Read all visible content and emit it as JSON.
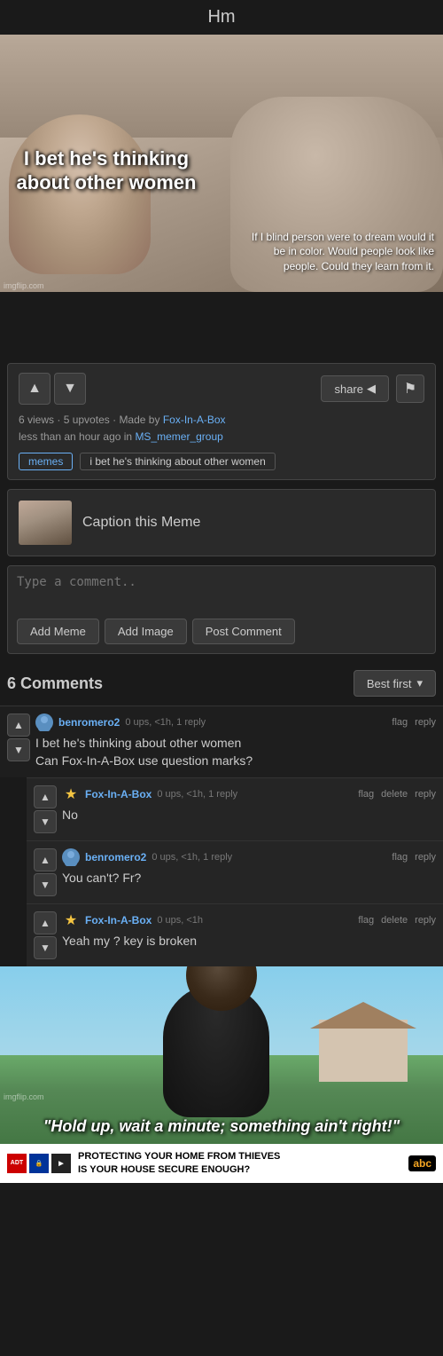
{
  "page": {
    "title": "Hm"
  },
  "meme": {
    "top_text": "I bet he's thinking about other women",
    "bottom_text_right": "If I blind person were to dream would it be in color. Would people look like people. Could they learn from it.",
    "credit": "imgflip.com"
  },
  "actions": {
    "share_label": "share",
    "upvote_icon": "▲",
    "downvote_icon": "▼",
    "flag_icon": "⚑"
  },
  "meta": {
    "views": "6 views",
    "upvotes": "5 upvotes",
    "made_by_prefix": "Made by",
    "author": "Fox-In-A-Box",
    "posted_time": "less than an hour ago in",
    "group": "MS_memer_group"
  },
  "tags": {
    "tag1": "memes",
    "tag2": "i bet he's thinking about other women"
  },
  "caption": {
    "text": "Caption this Meme"
  },
  "comment_input": {
    "placeholder": "Type a comment..",
    "btn_add_meme": "Add Meme",
    "btn_add_image": "Add Image",
    "btn_post": "Post Comment"
  },
  "comments_section": {
    "header": "6 Comments",
    "sort_label": "Best first",
    "sort_icon": "▾"
  },
  "comments": [
    {
      "id": "c1",
      "username": "benromero2",
      "avatar_type": "user",
      "stats": "0 ups, <1h, 1 reply",
      "actions": [
        "flag",
        "reply"
      ],
      "text": "I bet he's thinking about other women\nCan Fox-In-A-Box use question marks?",
      "indented": false
    },
    {
      "id": "c2",
      "username": "Fox-In-A-Box",
      "avatar_type": "star",
      "stats": "0 ups, <1h, 1 reply",
      "actions": [
        "flag",
        "delete",
        "reply"
      ],
      "text": "No",
      "indented": true
    },
    {
      "id": "c3",
      "username": "benromero2",
      "avatar_type": "user",
      "stats": "0 ups, <1h, 1 reply",
      "actions": [
        "flag",
        "reply"
      ],
      "text": "You can't? Fr?",
      "indented": true
    },
    {
      "id": "c4",
      "username": "Fox-In-A-Box",
      "avatar_type": "star",
      "stats": "0 ups, <1h",
      "actions": [
        "flag",
        "delete",
        "reply"
      ],
      "text": "Yeah my ? key is broken",
      "indented": true
    }
  ],
  "bottom_meme": {
    "caption": "\"Hold up, wait a minute; something ain't right!\"",
    "credit": "imgflip.com",
    "ad_text": "PROTECTING YOUR HOME FROM THIEVES\nIS YOUR HOUSE SECURE ENOUGH?",
    "network": "abc"
  }
}
